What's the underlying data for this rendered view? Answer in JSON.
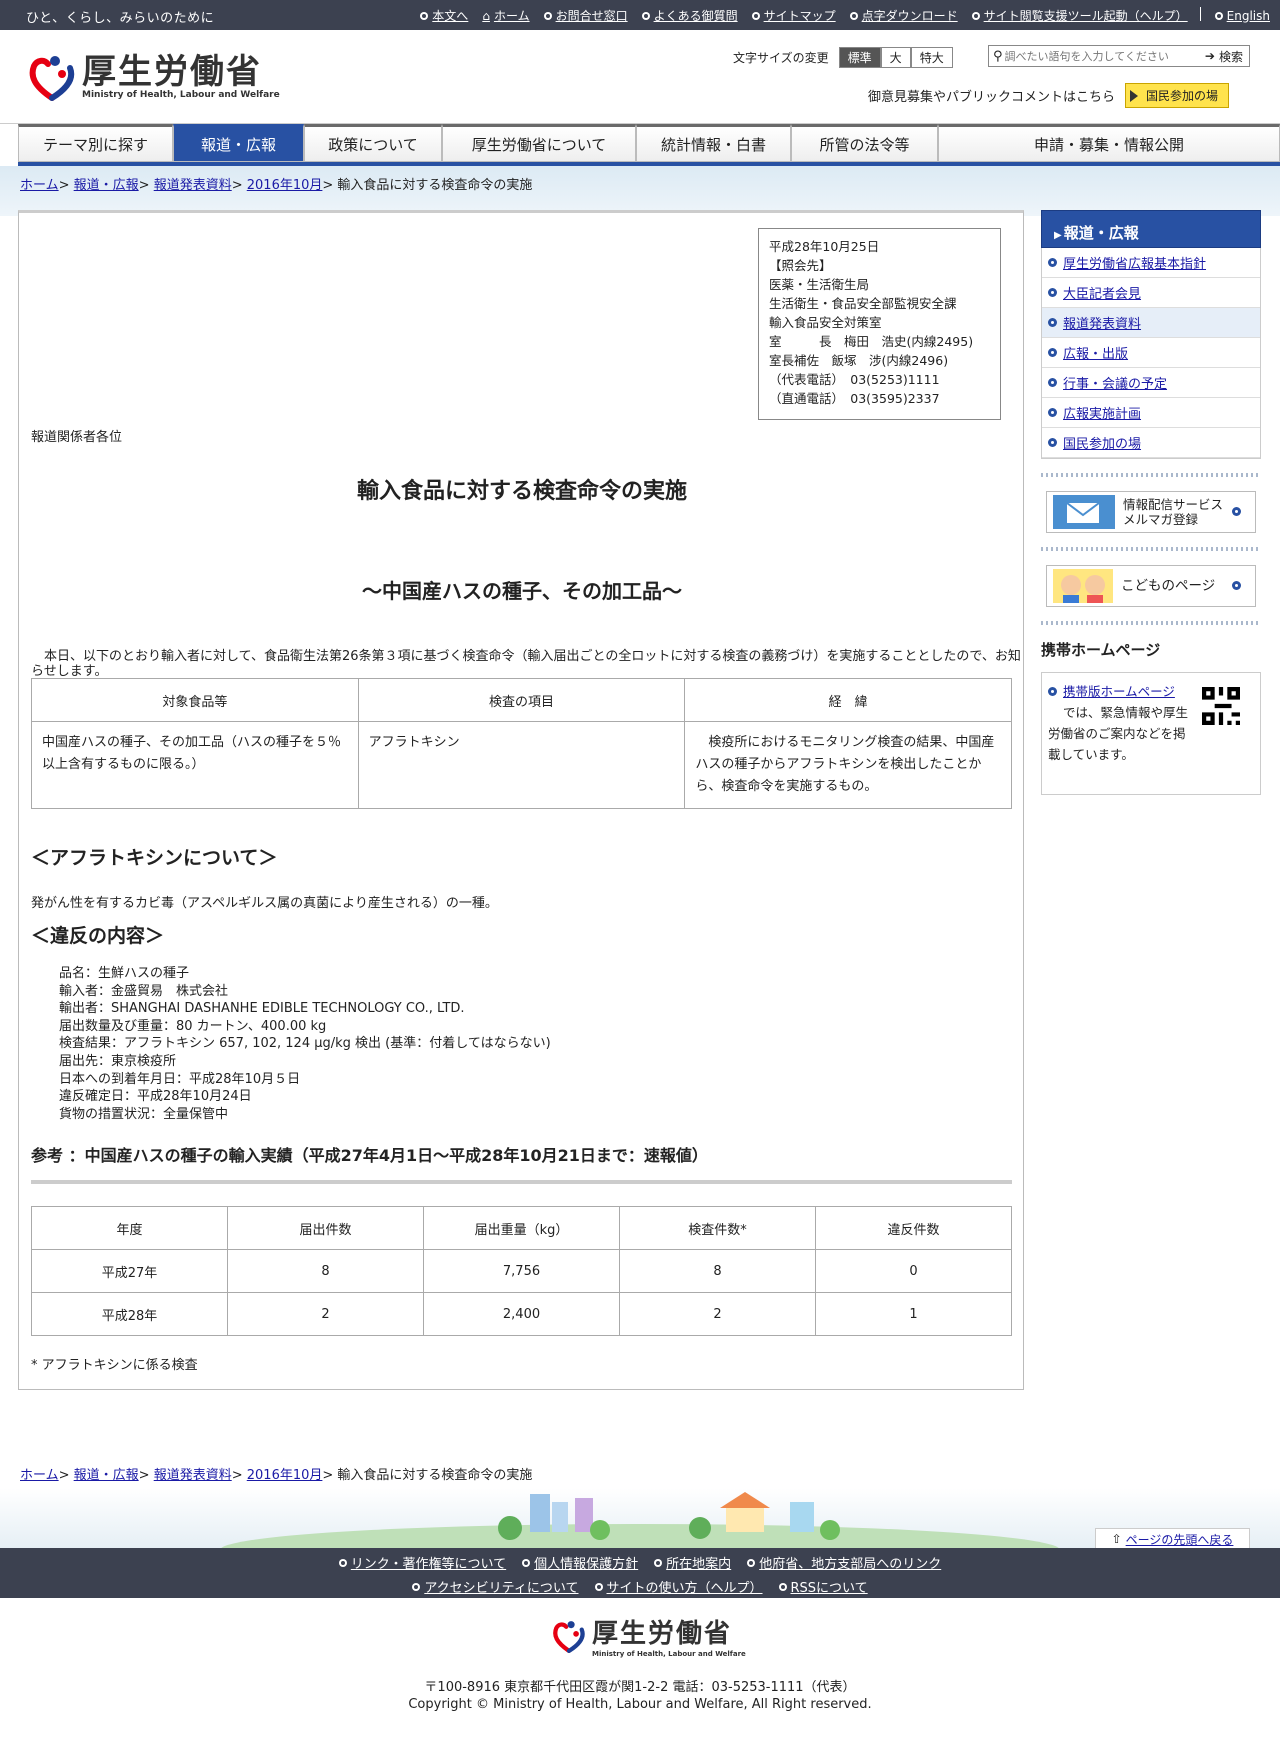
{
  "topbar": {
    "tagline": "ひと、くらし、みらいのために",
    "links": [
      "本文へ",
      "ホーム",
      "お問合せ窓口",
      "よくある御質問",
      "サイトマップ",
      "点字ダウンロード",
      "サイト閲覧支援ツール起動（ヘルプ）",
      "English"
    ]
  },
  "header": {
    "logo_jp": "厚生労働省",
    "logo_en": "Ministry of Health, Labour and Welfare",
    "fontsize_label": "文字サイズの変更",
    "fontsize_options": [
      "標準",
      "大",
      "特大"
    ],
    "search_placeholder": "調べたい語句を入力してください",
    "search_button": "検索",
    "public_comment": "御意見募集やパブリックコメントはこちら",
    "participation_button": "国民参加の場"
  },
  "nav": [
    "テーマ別に探す",
    "報道・広報",
    "政策について",
    "厚生労働省について",
    "統計情報・白書",
    "所管の法令等",
    "申請・募集・情報公開"
  ],
  "breadcrumb": {
    "items": [
      "ホーム",
      "報道・広報",
      "報道発表資料",
      "2016年10月"
    ],
    "current": "輸入食品に対する検査命令の実施"
  },
  "contact": {
    "text": "平成28年10月25日\n【照会先】\n医薬・生活衛生局\n生活衛生・食品安全部監視安全課\n輸入食品安全対策室\n室　　　長　梅田　浩史(内線2495)\n室長補佐　飯塚　涉(内線2496)\n（代表電話）　03(5253)1111\n（直通電話）　03(3595)2337"
  },
  "article": {
    "addressee": "報道関係者各位",
    "title": "輸入食品に対する検査命令の実施",
    "subtitle": "～中国産ハスの種子、その加工品～",
    "lead": "　本日、以下のとおり輸入者に対して、食品衛生法第26条第３項に基づく検査命令（輸入届出ごとの全ロットに対する検査の義務づけ）を実施することとしたので、お知らせします。",
    "table1": {
      "headers": [
        "対象食品等",
        "検査の項目",
        "経　緯"
      ],
      "row": [
        "中国産ハスの種子、その加工品（ハスの種子を５％以上含有するものに限る。）",
        "アフラトキシン",
        "　検疫所におけるモニタリング検査の結果、中国産ハスの種子からアフラトキシンを検出したことから、検査命令を実施するもの。"
      ]
    },
    "aflatoxin_heading": "＜アフラトキシンについて＞",
    "aflatoxin_text": "発がん性を有するカビ毒（アスペルギルス属の真菌により産生される）の一種。",
    "violation_heading": "＜違反の内容＞",
    "violation_items": [
      "品名：生鮮ハスの種子",
      "輸入者：金盛貿易　株式会社",
      "輸出者：SHANGHAI DASHANHE EDIBLE TECHNOLOGY CO., LTD.",
      "届出数量及び重量：80 カートン、400.00 kg",
      "検査結果：アフラトキシン 657, 102, 124 μg/kg 検出 (基準：付着してはならない)",
      "届出先：東京検疫所",
      "日本への到着年月日：平成28年10月５日",
      "違反確定日：平成28年10月24日",
      "貨物の措置状況：全量保管中"
    ],
    "reference_heading": "参考 ：中国産ハスの種子の輸入実績（平成27年4月1日～平成28年10月21日まで：速報値）",
    "table2": {
      "headers": [
        "年度",
        "届出件数",
        "届出重量（kg）",
        "検査件数*",
        "違反件数"
      ],
      "rows": [
        [
          "平成27年",
          "8",
          "7,756",
          "8",
          "0"
        ],
        [
          "平成28年",
          "2",
          "2,400",
          "2",
          "1"
        ]
      ]
    },
    "footnote": "* アフラトキシンに係る検査"
  },
  "sidebar": {
    "heading": "報道・広報",
    "items": [
      "厚生労働省広報基本指針",
      "大臣記者会見",
      "報道発表資料",
      "広報・出版",
      "行事・会議の予定",
      "広報実施計画",
      "国民参加の場"
    ],
    "banner_mail_1": "情報配信サービス",
    "banner_mail_2": "メルマガ登録",
    "banner_kids": "こどものページ",
    "mobile_heading": "携帯ホームページ",
    "mobile_link": "携帯版ホームページ",
    "mobile_text": "では、緊急情報や厚生労働省のご案内などを掲載しています。"
  },
  "footer": {
    "to_top": "ページの先頭へ戻る",
    "links_row1": [
      "リンク・著作権等について",
      "個人情報保護方針",
      "所在地案内",
      "他府省、地方支部局へのリンク"
    ],
    "links_row2": [
      "アクセシビリティについて",
      "サイトの使い方（ヘルプ）",
      "RSSについて"
    ],
    "logo_jp": "厚生労働省",
    "logo_en": "Ministry of Health, Labour and Welfare",
    "address": "〒100-8916 東京都千代田区霞が関1-2-2 電話：03-5253-1111（代表）",
    "copyright": "Copyright © Ministry of Health, Labour and Welfare, All Right reserved."
  }
}
